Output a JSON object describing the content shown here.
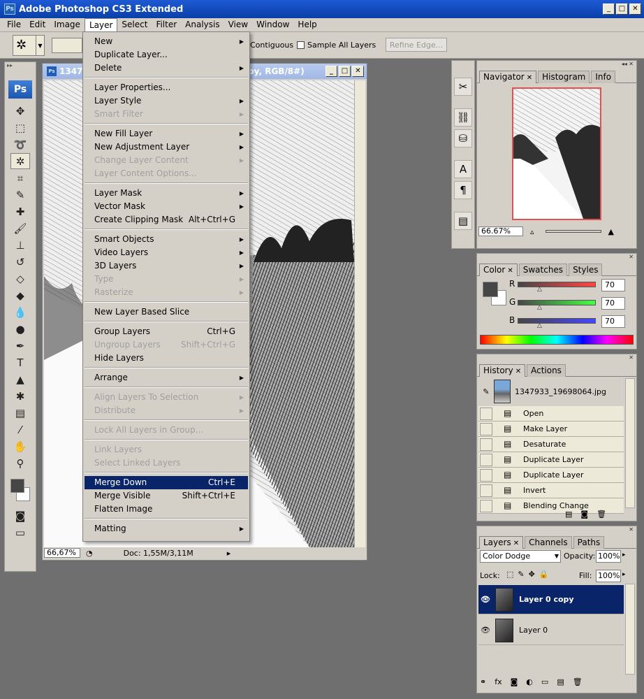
{
  "app": {
    "title": "Adobe Photoshop CS3 Extended",
    "icon": "Ps"
  },
  "window_buttons": {
    "min": "_",
    "max": "□",
    "close": "✕"
  },
  "menubar": [
    "File",
    "Edit",
    "Image",
    "Layer",
    "Select",
    "Filter",
    "Analysis",
    "View",
    "Window",
    "Help"
  ],
  "options_bar": {
    "contiguous": "Contiguous",
    "sample_all": "Sample All Layers",
    "refine_edge": "Refine Edge..."
  },
  "toolbox": {
    "logo": "Ps"
  },
  "document": {
    "title_left": "1347",
    "title_right": "py, RGB/8#)",
    "zoom": "66,67%",
    "doc_info": "Doc: 1,55M/3,11M"
  },
  "layer_menu": {
    "items": [
      {
        "label": "New",
        "submenu": true
      },
      {
        "label": "Duplicate Layer..."
      },
      {
        "label": "Delete",
        "submenu": true
      },
      {
        "sep": true
      },
      {
        "label": "Layer Properties..."
      },
      {
        "label": "Layer Style",
        "submenu": true
      },
      {
        "label": "Smart Filter",
        "submenu": true,
        "disabled": true
      },
      {
        "sep": true
      },
      {
        "label": "New Fill Layer",
        "submenu": true
      },
      {
        "label": "New Adjustment Layer",
        "submenu": true
      },
      {
        "label": "Change Layer Content",
        "submenu": true,
        "disabled": true
      },
      {
        "label": "Layer Content Options...",
        "disabled": true
      },
      {
        "sep": true
      },
      {
        "label": "Layer Mask",
        "submenu": true
      },
      {
        "label": "Vector Mask",
        "submenu": true
      },
      {
        "label": "Create Clipping Mask",
        "shortcut": "Alt+Ctrl+G"
      },
      {
        "sep": true
      },
      {
        "label": "Smart Objects",
        "submenu": true
      },
      {
        "label": "Video Layers",
        "submenu": true
      },
      {
        "label": "3D Layers",
        "submenu": true
      },
      {
        "label": "Type",
        "submenu": true,
        "disabled": true
      },
      {
        "label": "Rasterize",
        "submenu": true,
        "disabled": true
      },
      {
        "sep": true
      },
      {
        "label": "New Layer Based Slice"
      },
      {
        "sep": true
      },
      {
        "label": "Group Layers",
        "shortcut": "Ctrl+G"
      },
      {
        "label": "Ungroup Layers",
        "shortcut": "Shift+Ctrl+G",
        "disabled": true
      },
      {
        "label": "Hide Layers"
      },
      {
        "sep": true
      },
      {
        "label": "Arrange",
        "submenu": true
      },
      {
        "sep": true
      },
      {
        "label": "Align Layers To Selection",
        "submenu": true,
        "disabled": true
      },
      {
        "label": "Distribute",
        "submenu": true,
        "disabled": true
      },
      {
        "sep": true
      },
      {
        "label": "Lock All Layers in Group...",
        "disabled": true
      },
      {
        "sep": true
      },
      {
        "label": "Link Layers",
        "disabled": true
      },
      {
        "label": "Select Linked Layers",
        "disabled": true
      },
      {
        "sep": true
      },
      {
        "label": "Merge Down",
        "shortcut": "Ctrl+E",
        "highlighted": true
      },
      {
        "label": "Merge Visible",
        "shortcut": "Shift+Ctrl+E"
      },
      {
        "label": "Flatten Image"
      },
      {
        "sep": true
      },
      {
        "label": "Matting",
        "submenu": true
      }
    ]
  },
  "navigator": {
    "tabs": [
      "Navigator",
      "Histogram",
      "Info"
    ],
    "zoom": "66.67%"
  },
  "color": {
    "tabs": [
      "Color",
      "Swatches",
      "Styles"
    ],
    "channels": [
      {
        "label": "R",
        "value": "70"
      },
      {
        "label": "G",
        "value": "70"
      },
      {
        "label": "B",
        "value": "70"
      }
    ],
    "foreground": "#464646"
  },
  "history": {
    "tabs": [
      "History",
      "Actions"
    ],
    "snapshot": "1347933_19698064.jpg",
    "steps": [
      "Open",
      "Make Layer",
      "Desaturate",
      "Duplicate Layer",
      "Duplicate Layer",
      "Invert",
      "Blending Change"
    ]
  },
  "layers": {
    "tabs": [
      "Layers",
      "Channels",
      "Paths"
    ],
    "blend_mode": "Color Dodge",
    "opacity_label": "Opacity:",
    "opacity": "100%",
    "lock_label": "Lock:",
    "fill_label": "Fill:",
    "fill": "100%",
    "items": [
      {
        "name": "Layer 0 copy",
        "selected": true
      },
      {
        "name": "Layer 0",
        "selected": false
      }
    ]
  }
}
